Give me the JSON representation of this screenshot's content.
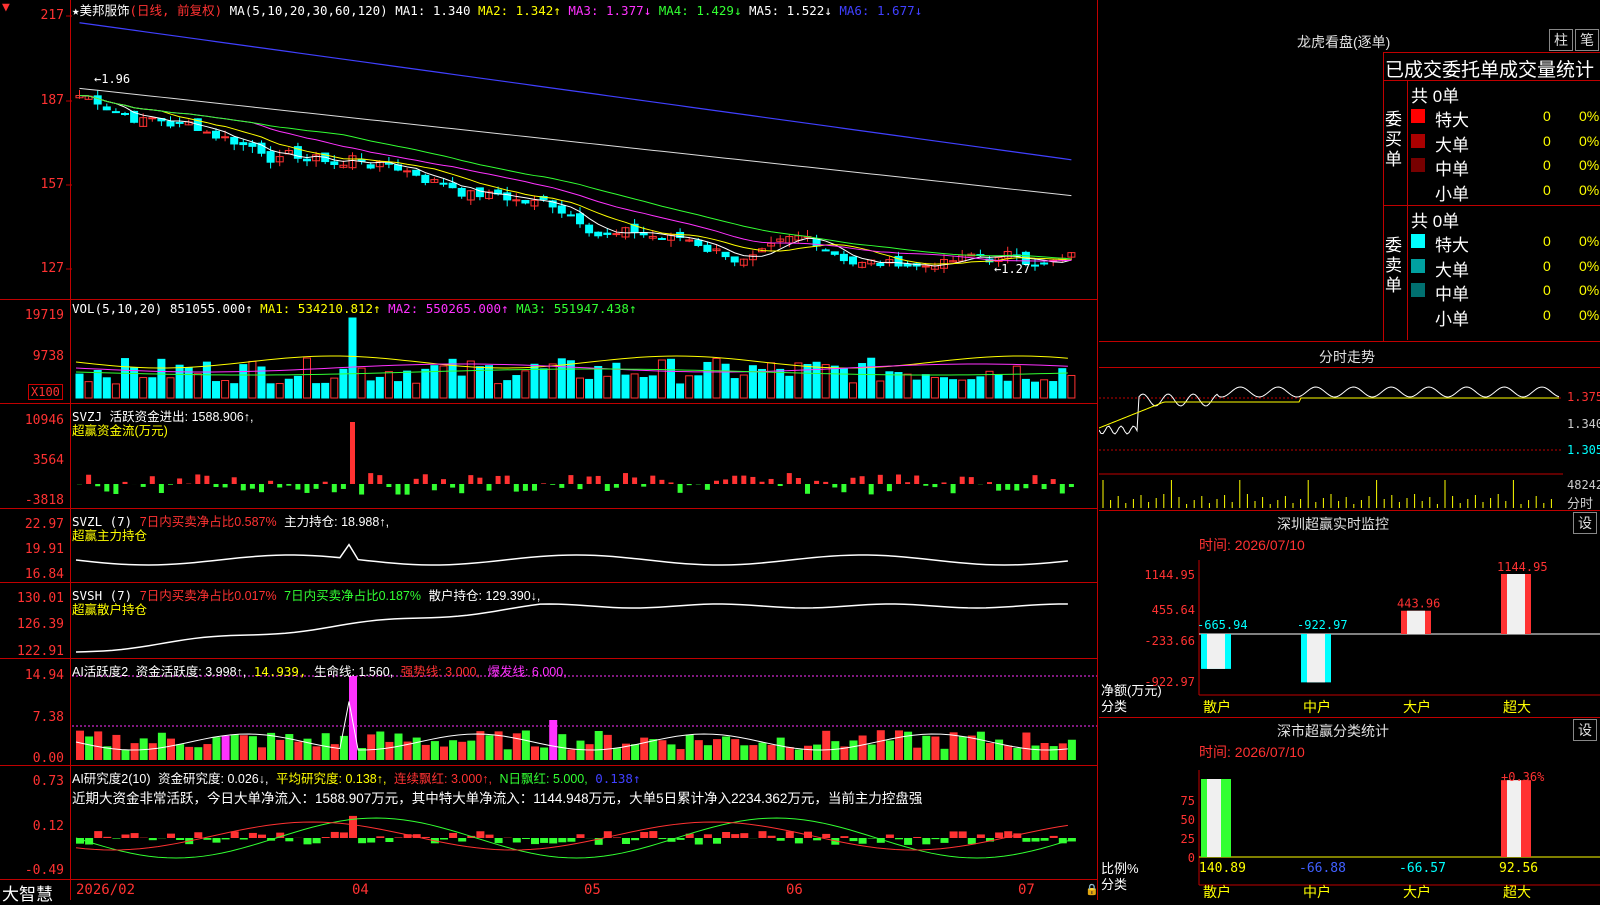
{
  "stock": {
    "name": "★美邦服饰",
    "mode": "(日线, 前复权)",
    "ma_label": "MA(5,10,20,30,60,120)",
    "ma1": "MA1: 1.340",
    "ma2": "MA2: 1.342↑",
    "ma3": "MA3: 1.377↓",
    "ma4": "MA4: 1.429↓",
    "ma5": "MA5: 1.522↓",
    "ma6": "MA6: 1.677↓",
    "high_mark": "←1.96",
    "low_mark": "←1.27",
    "yticks": [
      "217",
      "187",
      "157",
      "127"
    ]
  },
  "vol": {
    "label": "VOL(5,10,20)",
    "value": "851055.000↑",
    "ma1": "MA1: 534210.812↑",
    "ma2": "MA2: 550265.000↑",
    "ma3": "MA3: 551947.438↑",
    "yticks": [
      "19719",
      "9738"
    ],
    "unit": "X100"
  },
  "svzj": {
    "label": "SVZJ",
    "desc": "活跃资金进出: 1588.906↑,",
    "desc2": "超赢资金流(万元)",
    "yticks": [
      "10946",
      "3564",
      "-3818"
    ]
  },
  "svzl": {
    "label": "SVZL (7)",
    "p1": "7日内买卖净占比0.587%",
    "p2": "主力持仓: 18.988↑,",
    "desc2": "超赢主力持仓",
    "yticks": [
      "22.97",
      "19.91",
      "16.84"
    ]
  },
  "svsh": {
    "label": "SVSH (7)",
    "p1": "7日内买卖净占比0.017%",
    "p2": "7日内买卖净占比0.187%",
    "p3": "散户持仓: 129.390↓,",
    "desc2": "超赢散户持仓",
    "yticks": [
      "130.01",
      "126.39",
      "122.91"
    ]
  },
  "ai1": {
    "label": "AI活跃度2",
    "p1": "资金活跃度: 3.998↑,",
    "p2": "14.939,",
    "p3": "生命线: 1.560,",
    "p4": "强势线: 3.000,",
    "p5": "爆发线: 6.000,",
    "yticks": [
      "14.94",
      "7.38",
      "0.00"
    ]
  },
  "ai2": {
    "label": "AI研究度2(10)",
    "p1": "资金研究度: 0.026↓,",
    "p2": "平均研究度: 0.138↑,",
    "p3": "连续飘红: 3.000↑,",
    "p4": "N日飘红: 5.000,",
    "p5": "0.138↑",
    "comment": "近期大资金非常活跃，今日大单净流入：1588.907万元，其中特大单净流入：1144.948万元，大单5日累计净入2234.362万元，当前主力控盘强",
    "yticks": [
      "0.73",
      "0.12",
      "-0.49"
    ]
  },
  "footer": {
    "app": "大智慧",
    "dates": [
      "2026/02",
      "04",
      "05",
      "06",
      "07"
    ]
  },
  "dragon": {
    "title": "龙虎看盘(逐单)",
    "tab1": "柱",
    "tab2": "笔",
    "heading": "已成交委托单成交量统计",
    "buy": {
      "side": "委买单",
      "total": "共 0单",
      "rows": [
        {
          "label": "特大",
          "count": "0",
          "pct": "0%",
          "color": "#ff0000"
        },
        {
          "label": "大单",
          "count": "0",
          "pct": "0%",
          "color": "#aa0000"
        },
        {
          "label": "中单",
          "count": "0",
          "pct": "0%",
          "color": "#770000"
        },
        {
          "label": "小单",
          "count": "0",
          "pct": "0%",
          "color": "#000000"
        }
      ]
    },
    "sell": {
      "side": "委卖单",
      "total": "共 0单",
      "rows": [
        {
          "label": "特大",
          "count": "0",
          "pct": "0%",
          "color": "#00ffff"
        },
        {
          "label": "大单",
          "count": "0",
          "pct": "0%",
          "color": "#00a0a0"
        },
        {
          "label": "中单",
          "count": "0",
          "pct": "0%",
          "color": "#007070"
        },
        {
          "label": "小单",
          "count": "0",
          "pct": "0%",
          "color": "#000000"
        }
      ]
    }
  },
  "intraday": {
    "title": "分时走势",
    "prices": [
      "1.375",
      "1.340",
      "1.305"
    ],
    "vol": "48242",
    "vol_unit": "分时"
  },
  "monitor": {
    "title": "深圳超赢实时监控",
    "btn": "设",
    "time": "时间: 2026/07/10",
    "unit": "净额(万元)",
    "cat": "分类",
    "yticks": [
      "1144.95",
      "455.64",
      "-233.66",
      "-922.97"
    ],
    "categories": [
      "散户",
      "中户",
      "大户",
      "超大"
    ],
    "values": [
      -665.94,
      -922.97,
      443.96,
      1144.95
    ],
    "labels": [
      "-665.94",
      "-922.97",
      "443.96",
      "1144.95"
    ]
  },
  "classify": {
    "title": "深市超赢分类统计",
    "btn": "设",
    "time": "时间: 2026/07/10",
    "unit": "比例%",
    "cat": "分类",
    "yticks": [
      "75",
      "50",
      "25",
      "0"
    ],
    "categories": [
      "散户",
      "中户",
      "大户",
      "超大"
    ],
    "values": [
      140.89,
      -66.88,
      -66.57,
      92.56
    ],
    "labels": [
      "140.89",
      "-66.88",
      "-66.57",
      "92.56"
    ],
    "top_label": "+0.36%"
  }
}
